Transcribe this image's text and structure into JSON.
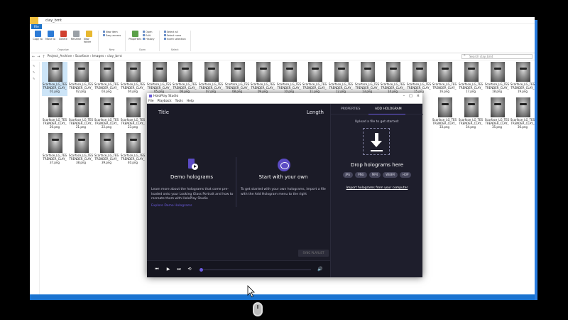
{
  "explorer": {
    "title": "clay_brnt",
    "file_tab": "File",
    "ribbon": {
      "buttons": [
        {
          "label": "Copy to",
          "color": "blue"
        },
        {
          "label": "Move to",
          "color": "blue"
        },
        {
          "label": "Delete",
          "color": "red"
        },
        {
          "label": "Rename",
          "color": "gray"
        },
        {
          "label": "New folder",
          "color": "yel"
        }
      ],
      "new_items": [
        "New item",
        "Easy access"
      ],
      "properties": "Properties",
      "open_items": [
        "Open",
        "Edit",
        "History"
      ],
      "select_items": [
        "Select all",
        "Select none",
        "Invert selection"
      ],
      "groups": [
        "Organize",
        "New",
        "Open",
        "Select"
      ]
    },
    "address": "Project_Archive  ›  Scarface  ›  Images  ›  clay_brnt",
    "search_placeholder": "Search clay_brnt",
    "thumbs": [
      {
        "l1": "Scarface_LG_TES",
        "l2": "TRENDER_CLAY_",
        "l3": "01.png",
        "sel": true
      },
      {
        "l1": "Scarface_LG_TES",
        "l2": "TRENDER_CLAY_",
        "l3": "02.png"
      },
      {
        "l1": "Scarface_LG_TES",
        "l2": "TRENDER_CLAY_",
        "l3": "03.png"
      },
      {
        "l1": "Scarface_LG_TES",
        "l2": "TRENDER_CLAY_",
        "l3": "04.png"
      },
      {
        "l1": "Scarface_LG_TES",
        "l2": "TRENDER_CLAY_",
        "l3": "05.png"
      },
      {
        "l1": "Scarface_LG_TES",
        "l2": "TRENDER_CLAY_",
        "l3": "06.png"
      },
      {
        "l1": "Scarface_LG_TES",
        "l2": "TRENDER_CLAY_",
        "l3": "07.png"
      },
      {
        "l1": "Scarface_LG_TES",
        "l2": "TRENDER_CLAY_",
        "l3": "08.png"
      },
      {
        "l1": "Scarface_LG_TES",
        "l2": "TRENDER_CLAY_",
        "l3": "09.png"
      },
      {
        "l1": "Scarface_LG_TES",
        "l2": "TRENDER_CLAY_",
        "l3": "10.png"
      },
      {
        "l1": "Scarface_LG_TES",
        "l2": "TRENDER_CLAY_",
        "l3": "11.png"
      },
      {
        "l1": "Scarface_LG_TES",
        "l2": "TRENDER_CLAY_",
        "l3": "12.png"
      },
      {
        "l1": "Scarface_LG_TES",
        "l2": "TRENDER_CLAY_",
        "l3": "13.png"
      },
      {
        "l1": "Scarface_LG_TES",
        "l2": "TRENDER_CLAY_",
        "l3": "14.png"
      },
      {
        "l1": "Scarface_LG_TES",
        "l2": "TRENDER_CLAY_",
        "l3": "15.png"
      },
      {
        "l1": "Scarface_LG_TES",
        "l2": "TRENDER_CLAY_",
        "l3": "16.png"
      },
      {
        "l1": "Scarface_LG_TES",
        "l2": "TRENDER_CLAY_",
        "l3": "17.png"
      },
      {
        "l1": "Scarface_LG_TES",
        "l2": "TRENDER_CLAY_",
        "l3": "18.png"
      },
      {
        "l1": "Scarface_LG_TES",
        "l2": "TRENDER_CLAY_",
        "l3": "19.png"
      },
      {
        "l1": "Scarface_LG_TES",
        "l2": "TRENDER_CLAY_",
        "l3": "20.png"
      },
      {
        "l1": "Scarface_LG_TES",
        "l2": "TRENDER_CLAY_",
        "l3": "21.png"
      },
      {
        "l1": "Scarface_LG_TES",
        "l2": "TRENDER_CLAY_",
        "l3": "22.png"
      },
      {
        "l1": "Scarface_LG_TES",
        "l2": "TRENDER_CLAY_",
        "l3": "23.png"
      },
      {
        "l1": "Scarface_LG_TES",
        "l2": "TRENDER_CLAY_",
        "l3": "33.png"
      },
      {
        "l1": "Scarface_LG_TES",
        "l2": "TRENDER_CLAY_",
        "l3": "34.png"
      },
      {
        "l1": "Scarface_LG_TES",
        "l2": "TRENDER_CLAY_",
        "l3": "35.png"
      },
      {
        "l1": "Scarface_LG_TES",
        "l2": "TRENDER_CLAY_",
        "l3": "36.png"
      },
      {
        "l1": "Scarface_LG_TES",
        "l2": "TRENDER_CLAY_",
        "l3": "37.png"
      },
      {
        "l1": "Scarface_LG_TES",
        "l2": "TRENDER_CLAY_",
        "l3": "38.png"
      },
      {
        "l1": "Scarface_LG_TES",
        "l2": "TRENDER_CLAY_",
        "l3": "39.png"
      },
      {
        "l1": "Scarface_LG_TES",
        "l2": "TRENDER_CLAY_",
        "l3": "40.png"
      },
      {
        "l1": "Scarface_LG_TES",
        "l2": "TRENDER_CLAY_",
        "l3": "41.png"
      },
      {
        "l1": "Scarface_LG_TES",
        "l2": "TRENDER_CLAY_",
        "l3": "42.png"
      }
    ]
  },
  "holo": {
    "window_title": "HoloPlay Studio",
    "menu": [
      "File",
      "Playback",
      "Tools",
      "Help"
    ],
    "playlist_title": "Title",
    "playlist_length": "Length",
    "demo_heading": "Demo holograms",
    "demo_text": "Learn more about the holograms that come pre-loaded onto your Looking Glass Portrait and how to recreate them with HoloPlay Studio",
    "demo_link": "Explore Demo Holograms",
    "own_heading": "Start with your own",
    "own_text": "To get started with your own holograms, import a file with the Add Hologram menu to the right",
    "sync_button": "SYNC PLAYLIST",
    "tab_properties": "PROPERTIES",
    "tab_add": "ADD HOLOGRAM",
    "upload_text": "Upload a file to get started:",
    "drop_heading": "Drop holograms here",
    "formats": [
      "JPG",
      "PNG",
      "MP4",
      "WEBM",
      "HOP"
    ],
    "import_link": "Import holograms from your computer",
    "accent": "#6b5be0"
  }
}
